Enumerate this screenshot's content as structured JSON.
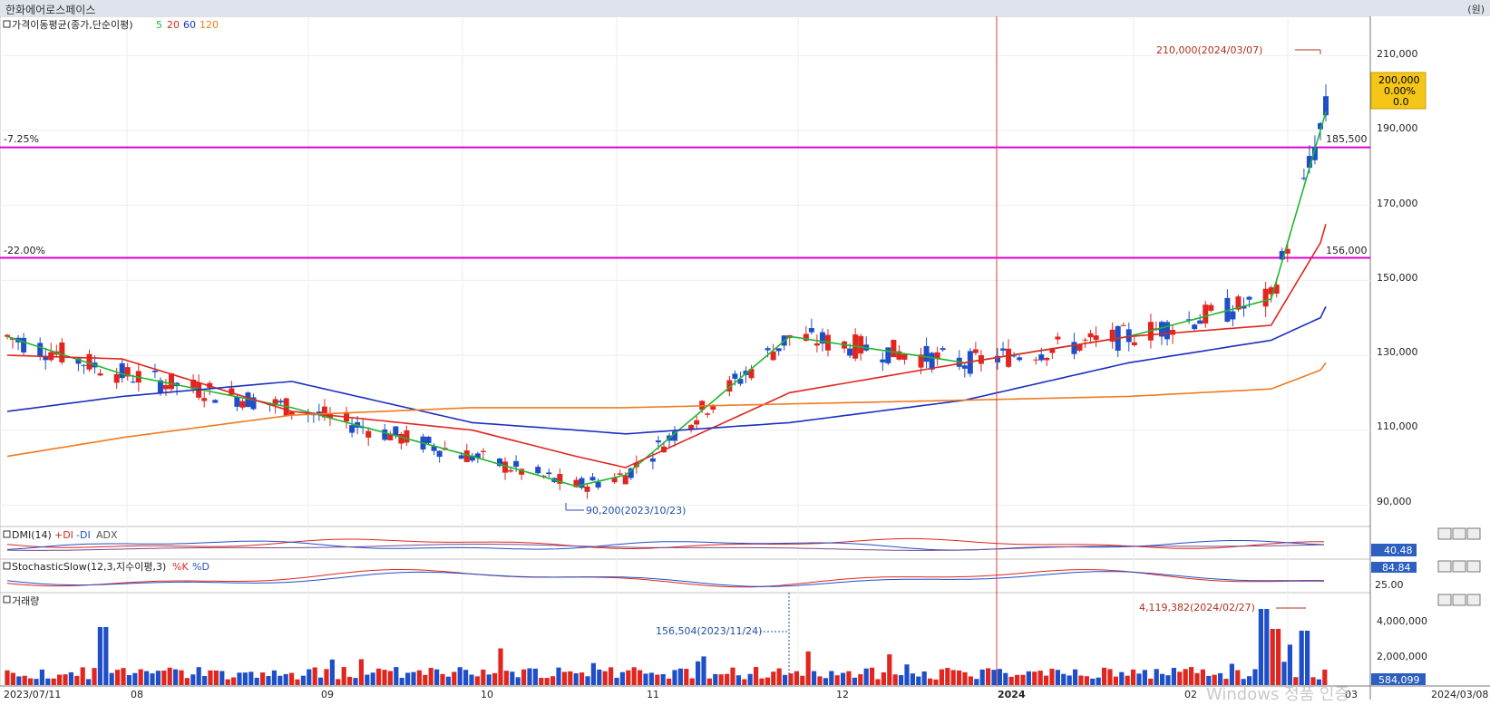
{
  "window": {
    "title": "한화에어로스페이스",
    "unit": "(원)"
  },
  "watermark": "Windows 정품 인증",
  "colors": {
    "up": "#e0261f",
    "down": "#1f4fc8",
    "ma5": "#22b530",
    "ma20": "#e0261f",
    "ma60": "#1a2fbf",
    "ma120": "#f07a20",
    "level": "#e000d0"
  },
  "price_panel": {
    "legend": {
      "label": "가격이동평균(종가,단순이평)",
      "periods": [
        "5",
        "20",
        "60",
        "120"
      ]
    },
    "y_ticks": [
      "210,000",
      "190,000",
      "170,000",
      "150,000",
      "130,000",
      "110,000",
      "90,000"
    ],
    "levels": [
      {
        "pct": "-7.25%",
        "price_label": "185,500",
        "value": 185500
      },
      {
        "pct": "-22.00%",
        "price_label": "156,000",
        "value": 156000
      }
    ],
    "current": {
      "price": "200,000",
      "change_pct": "0.00%",
      "change": "0.0"
    },
    "annotations": {
      "high": "210,000(2024/03/07)",
      "low": "90,200(2023/10/23)"
    }
  },
  "dmi_panel": {
    "label": "DMI(14)",
    "legend": [
      "+DI",
      "-DI",
      "ADX"
    ],
    "value": "40.48",
    "scale": "25.00"
  },
  "stoch_panel": {
    "label": "StochasticSlow(12,3,지수이평,3)",
    "legend": [
      "%K",
      "%D"
    ],
    "value": "84.84",
    "scale": "25.00"
  },
  "volume_panel": {
    "label": "거래량",
    "y_ticks": [
      "4,000,000",
      "2,000,000"
    ],
    "current": "584,099",
    "annotations": {
      "high": "4,119,382(2024/02/27)",
      "marker": "156,504(2023/11/24)"
    }
  },
  "x_axis": {
    "start": "2023/07/11",
    "end": "2024/03/08",
    "ticks": [
      "08",
      "09",
      "10",
      "11",
      "12",
      "2024",
      "02",
      "03"
    ]
  },
  "chart_data": [
    {
      "type": "line",
      "title": "가격이동평균(종가,단순이평)",
      "ylim": [
        85000,
        220000
      ],
      "x": [
        "2023-07-11",
        "2023-08-01",
        "2023-09-01",
        "2023-10-04",
        "2023-10-23",
        "2023-11-01",
        "2023-12-01",
        "2024-01-02",
        "2024-02-01",
        "2024-02-27",
        "2024-03-07",
        "2024-03-08"
      ],
      "series": [
        {
          "name": "5",
          "values": [
            135000,
            125000,
            116000,
            103000,
            95000,
            98000,
            135000,
            128000,
            135000,
            145000,
            190000,
            195000
          ]
        },
        {
          "name": "20",
          "values": [
            130000,
            129000,
            115000,
            110000,
            103000,
            100000,
            120000,
            128000,
            135000,
            138000,
            160000,
            165000
          ]
        },
        {
          "name": "60",
          "values": [
            115000,
            119000,
            123000,
            112000,
            110000,
            109000,
            112000,
            118000,
            128000,
            134000,
            140000,
            143000
          ]
        },
        {
          "name": "120",
          "values": [
            103000,
            108000,
            114000,
            116000,
            116000,
            116000,
            117000,
            118000,
            119000,
            121000,
            126000,
            128000
          ]
        }
      ],
      "annotations": [
        {
          "x": "2024-03-07",
          "y": 210000,
          "text": "210,000(2024/03/07)"
        },
        {
          "x": "2023-10-23",
          "y": 90200,
          "text": "90,200(2023/10/23)"
        }
      ]
    },
    {
      "type": "bar",
      "title": "거래량",
      "annotations": [
        {
          "x": "2024-02-27",
          "y": 4119382,
          "text": "4,119,382(2024/02/27)"
        },
        {
          "x": "2023-11-24",
          "y": 156504,
          "text": "156,504(2023/11/24)"
        }
      ],
      "current": 584099
    }
  ]
}
